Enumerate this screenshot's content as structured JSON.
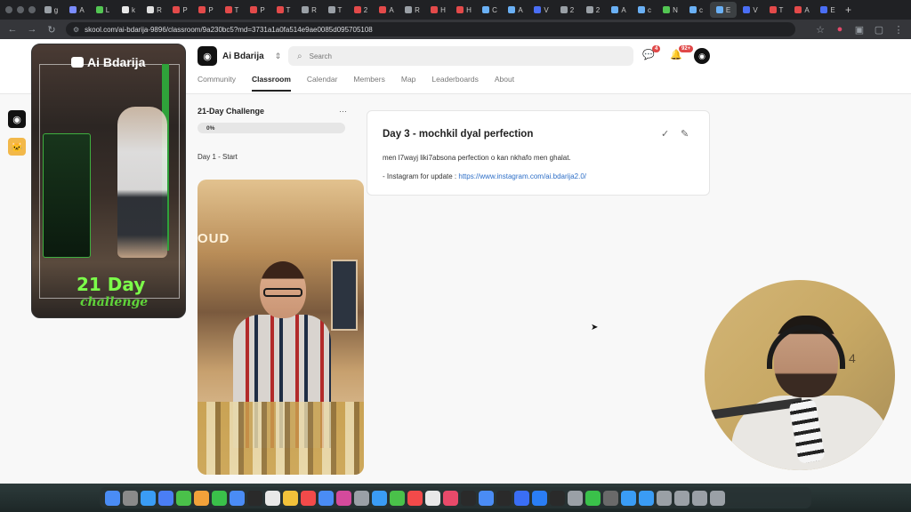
{
  "browser": {
    "tabs": [
      {
        "label": "g",
        "color": "#9aa0a6"
      },
      {
        "label": "A",
        "color": "#7b8cff"
      },
      {
        "label": "L",
        "color": "#53c653"
      },
      {
        "label": "k",
        "color": "#e8e8e8"
      },
      {
        "label": "R",
        "color": "#e0e0e0"
      },
      {
        "label": "P",
        "color": "#e34a4a"
      },
      {
        "label": "P",
        "color": "#e34a4a"
      },
      {
        "label": "T",
        "color": "#e34a4a"
      },
      {
        "label": "P",
        "color": "#e34a4a"
      },
      {
        "label": "T",
        "color": "#e34a4a"
      },
      {
        "label": "R",
        "color": "#9aa0a6"
      },
      {
        "label": "T",
        "color": "#9aa0a6"
      },
      {
        "label": "2",
        "color": "#e34a4a"
      },
      {
        "label": "A",
        "color": "#e34a4a"
      },
      {
        "label": "R",
        "color": "#9aa0a6"
      },
      {
        "label": "H",
        "color": "#e34a4a"
      },
      {
        "label": "H",
        "color": "#e34a4a"
      },
      {
        "label": "C",
        "color": "#6ab0f5"
      },
      {
        "label": "A",
        "color": "#6ab0f5"
      },
      {
        "label": "V",
        "color": "#4a6ef5"
      },
      {
        "label": "2",
        "color": "#9aa0a6"
      },
      {
        "label": "2",
        "color": "#9aa0a6"
      },
      {
        "label": "A",
        "color": "#6ab0f5"
      },
      {
        "label": "c",
        "color": "#6ab0f5"
      },
      {
        "label": "N",
        "color": "#53c653"
      },
      {
        "label": "c",
        "color": "#6ab0f5"
      },
      {
        "label": "E",
        "color": "#6ab0f5",
        "active": true
      },
      {
        "label": "V",
        "color": "#4a6ef5"
      },
      {
        "label": "T",
        "color": "#e34a4a"
      },
      {
        "label": "A",
        "color": "#e34a4a"
      },
      {
        "label": "E",
        "color": "#4a6ef5"
      }
    ],
    "new_tab": "+",
    "url": "skool.com/ai-bdarija-9896/classroom/9a230bc5?md=3731a1a0fa514e9ae0085d095705108"
  },
  "community": {
    "name": "Ai Bdarija",
    "search_placeholder": "Search",
    "chat_badge": "4",
    "notif_badge": "92+",
    "tabs": [
      "Community",
      "Classroom",
      "Calendar",
      "Members",
      "Map",
      "Leaderboards",
      "About"
    ],
    "active_tab": "Classroom"
  },
  "course": {
    "title": "21-Day Challenge",
    "progress": "0%",
    "module": "Day 1 - Start"
  },
  "lesson": {
    "title": "Day 3 - mochkil dyal perfection",
    "body": "men l7wayj liki7absona perfection o kan nkhafo men ghalat.",
    "instagram_prefix": "- Instagram for update : ",
    "instagram_link": "https://www.instagram.com/ai.bdarija2.0/"
  },
  "overlay": {
    "left_video_title": "Ai Bdarija",
    "left_video_big": "21 Day",
    "left_video_sub": "challenge",
    "mid_video_sign": "OUD",
    "cam_number": "4"
  },
  "dock_colors": [
    "#4a8cf5",
    "#8a8a8a",
    "#3a9cf5",
    "#4a7ef5",
    "#4ac14a",
    "#f2a23a",
    "#3ac14a",
    "#4a8cf5",
    "#2a2a2a",
    "#e8e8e8",
    "#f2c23a",
    "#f24a4a",
    "#4a8cf5",
    "#d44a9c",
    "#9aa0a6",
    "#3a9cf5",
    "#4ac14a",
    "#f24a4a",
    "#e8e8e8",
    "#e84a6a",
    "#2a2a2a",
    "#4a8cf5",
    "#2a2a2a",
    "#3a6ef5",
    "#2a7ef5",
    "#2a2a2a",
    "#9aa0a6",
    "#3ac14a",
    "#6a6a6a",
    "#3a9cf5",
    "#3a9cf5",
    "#9aa0a6",
    "#9aa0a6",
    "#9aa0a6",
    "#9aa0a6"
  ]
}
